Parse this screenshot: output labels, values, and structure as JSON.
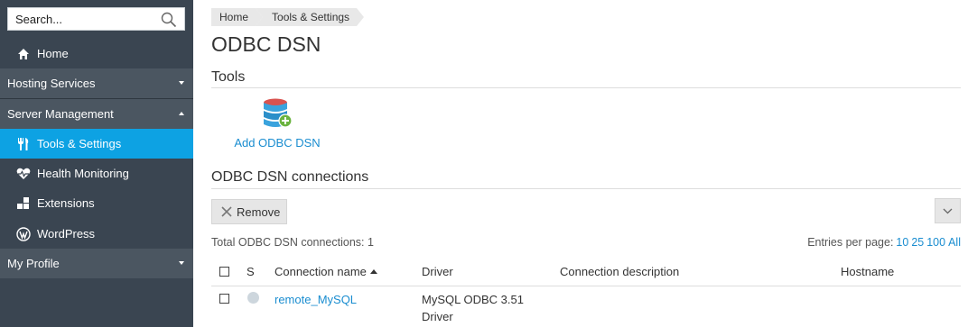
{
  "sidebar": {
    "search_placeholder": "Search...",
    "home": "Home",
    "hosting_services": "Hosting Services",
    "server_management": "Server Management",
    "tools_settings": "Tools & Settings",
    "health_monitoring": "Health Monitoring",
    "extensions": "Extensions",
    "wordpress": "WordPress",
    "my_profile": "My Profile"
  },
  "breadcrumb": [
    "Home",
    "Tools & Settings"
  ],
  "page_title": "ODBC DSN",
  "tools": {
    "title": "Tools",
    "add_label": "Add ODBC DSN"
  },
  "connections": {
    "title": "ODBC DSN connections",
    "remove_label": "Remove",
    "total": "Total ODBC DSN connections: 1",
    "entries_label": "Entries per page:",
    "entries_options": [
      "10",
      "25",
      "100",
      "All"
    ],
    "headers": {
      "status": "S",
      "name": "Connection name",
      "driver": "Driver",
      "description": "Connection description",
      "hostname": "Hostname"
    },
    "rows": [
      {
        "name": "remote_MySQL",
        "driver_line1": "MySQL ODBC 3.51",
        "driver_line2": "Driver",
        "description": "",
        "hostname": ""
      }
    ]
  },
  "colors": {
    "sidebar": "#3a4551",
    "group": "#4b5661",
    "active": "#0da2e3",
    "link": "#1a8dd0"
  }
}
